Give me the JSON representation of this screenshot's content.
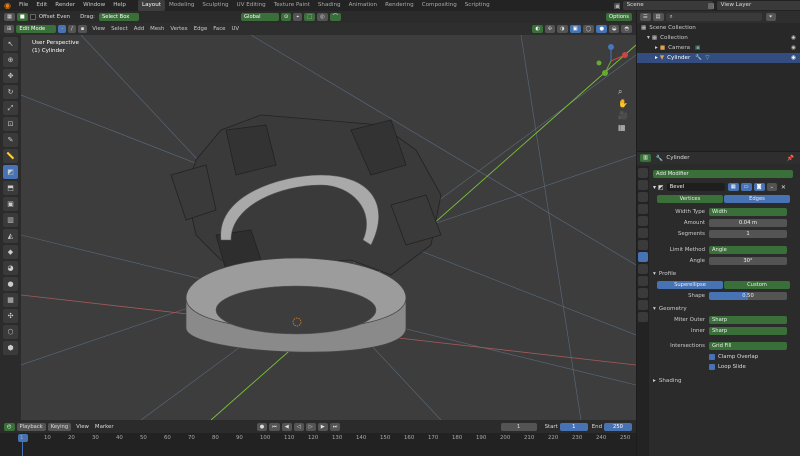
{
  "menu": {
    "items": [
      "File",
      "Edit",
      "Render",
      "Window",
      "Help"
    ]
  },
  "workspaces": [
    "Layout",
    "Modeling",
    "Sculpting",
    "UV Editing",
    "Texture Paint",
    "Shading",
    "Animation",
    "Rendering",
    "Compositing",
    "Scripting"
  ],
  "scene": {
    "name": "Scene",
    "view_layer": "View Layer"
  },
  "tool_header": {
    "offset_even": "Offset Even",
    "drag_label": "Drag:",
    "drag_value": "Select Box",
    "transform": "Global",
    "options": "Options"
  },
  "viewport_header": {
    "mode": "Edit Mode",
    "menus": [
      "View",
      "Select",
      "Add",
      "Mesh",
      "Vertex",
      "Edge",
      "Face",
      "UV"
    ]
  },
  "viewport": {
    "perspective": "User Perspective",
    "object": "(1) Cylinder"
  },
  "timeline": {
    "menus": [
      "Playback",
      "Keying",
      "View",
      "Marker"
    ],
    "current_frame": "1",
    "start_label": "Start",
    "start": "1",
    "end_label": "End",
    "end": "250",
    "ticks": [
      "1",
      "10",
      "20",
      "30",
      "40",
      "50",
      "60",
      "70",
      "80",
      "90",
      "100",
      "110",
      "120",
      "130",
      "140",
      "150",
      "160",
      "170",
      "180",
      "190",
      "200",
      "210",
      "220",
      "230",
      "240",
      "250"
    ]
  },
  "outliner": {
    "search_placeholder": "",
    "rows": [
      "Scene Collection",
      "Collection",
      "Camera",
      "Cylinder"
    ]
  },
  "properties": {
    "object_name": "Cylinder",
    "add_modifier": "Add Modifier",
    "modifier_name": "Bevel",
    "tabs": {
      "vertices": "Vertices",
      "edges": "Edges"
    },
    "width_type": {
      "label": "Width Type",
      "value": "Width"
    },
    "amount": {
      "label": "Amount",
      "value": "0.04 m"
    },
    "segments": {
      "label": "Segments",
      "value": "1"
    },
    "limit_method": {
      "label": "Limit Method",
      "value": "Angle"
    },
    "angle": {
      "label": "Angle",
      "value": "30°"
    },
    "profile": {
      "header": "Profile",
      "superellipse": "Superellipse",
      "custom": "Custom",
      "shape_label": "Shape",
      "shape_value": "0.50"
    },
    "geometry": {
      "header": "Geometry",
      "miter_outer": {
        "label": "Miter Outer",
        "value": "Sharp"
      },
      "inner": {
        "label": "Inner",
        "value": "Sharp"
      },
      "intersections": {
        "label": "Intersections",
        "value": "Grid Fill"
      },
      "clamp": "Clamp Overlap",
      "loop_slide": "Loop Slide"
    },
    "shading": "Shading"
  },
  "colors": {
    "accent": "#4772b3",
    "green": "#3a6f3a",
    "selection": "#334d80"
  }
}
